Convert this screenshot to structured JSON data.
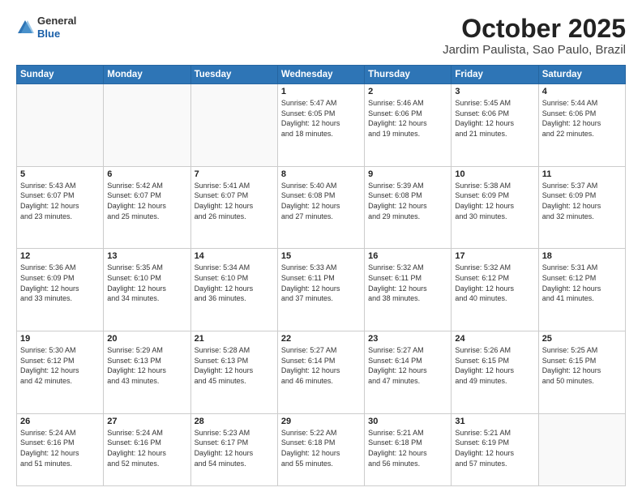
{
  "header": {
    "logo": {
      "line1": "General",
      "line2": "Blue"
    },
    "title": "October 2025",
    "subtitle": "Jardim Paulista, Sao Paulo, Brazil"
  },
  "weekdays": [
    "Sunday",
    "Monday",
    "Tuesday",
    "Wednesday",
    "Thursday",
    "Friday",
    "Saturday"
  ],
  "weeks": [
    [
      {
        "day": "",
        "info": ""
      },
      {
        "day": "",
        "info": ""
      },
      {
        "day": "",
        "info": ""
      },
      {
        "day": "1",
        "info": "Sunrise: 5:47 AM\nSunset: 6:05 PM\nDaylight: 12 hours\nand 18 minutes."
      },
      {
        "day": "2",
        "info": "Sunrise: 5:46 AM\nSunset: 6:06 PM\nDaylight: 12 hours\nand 19 minutes."
      },
      {
        "day": "3",
        "info": "Sunrise: 5:45 AM\nSunset: 6:06 PM\nDaylight: 12 hours\nand 21 minutes."
      },
      {
        "day": "4",
        "info": "Sunrise: 5:44 AM\nSunset: 6:06 PM\nDaylight: 12 hours\nand 22 minutes."
      }
    ],
    [
      {
        "day": "5",
        "info": "Sunrise: 5:43 AM\nSunset: 6:07 PM\nDaylight: 12 hours\nand 23 minutes."
      },
      {
        "day": "6",
        "info": "Sunrise: 5:42 AM\nSunset: 6:07 PM\nDaylight: 12 hours\nand 25 minutes."
      },
      {
        "day": "7",
        "info": "Sunrise: 5:41 AM\nSunset: 6:07 PM\nDaylight: 12 hours\nand 26 minutes."
      },
      {
        "day": "8",
        "info": "Sunrise: 5:40 AM\nSunset: 6:08 PM\nDaylight: 12 hours\nand 27 minutes."
      },
      {
        "day": "9",
        "info": "Sunrise: 5:39 AM\nSunset: 6:08 PM\nDaylight: 12 hours\nand 29 minutes."
      },
      {
        "day": "10",
        "info": "Sunrise: 5:38 AM\nSunset: 6:09 PM\nDaylight: 12 hours\nand 30 minutes."
      },
      {
        "day": "11",
        "info": "Sunrise: 5:37 AM\nSunset: 6:09 PM\nDaylight: 12 hours\nand 32 minutes."
      }
    ],
    [
      {
        "day": "12",
        "info": "Sunrise: 5:36 AM\nSunset: 6:09 PM\nDaylight: 12 hours\nand 33 minutes."
      },
      {
        "day": "13",
        "info": "Sunrise: 5:35 AM\nSunset: 6:10 PM\nDaylight: 12 hours\nand 34 minutes."
      },
      {
        "day": "14",
        "info": "Sunrise: 5:34 AM\nSunset: 6:10 PM\nDaylight: 12 hours\nand 36 minutes."
      },
      {
        "day": "15",
        "info": "Sunrise: 5:33 AM\nSunset: 6:11 PM\nDaylight: 12 hours\nand 37 minutes."
      },
      {
        "day": "16",
        "info": "Sunrise: 5:32 AM\nSunset: 6:11 PM\nDaylight: 12 hours\nand 38 minutes."
      },
      {
        "day": "17",
        "info": "Sunrise: 5:32 AM\nSunset: 6:12 PM\nDaylight: 12 hours\nand 40 minutes."
      },
      {
        "day": "18",
        "info": "Sunrise: 5:31 AM\nSunset: 6:12 PM\nDaylight: 12 hours\nand 41 minutes."
      }
    ],
    [
      {
        "day": "19",
        "info": "Sunrise: 5:30 AM\nSunset: 6:12 PM\nDaylight: 12 hours\nand 42 minutes."
      },
      {
        "day": "20",
        "info": "Sunrise: 5:29 AM\nSunset: 6:13 PM\nDaylight: 12 hours\nand 43 minutes."
      },
      {
        "day": "21",
        "info": "Sunrise: 5:28 AM\nSunset: 6:13 PM\nDaylight: 12 hours\nand 45 minutes."
      },
      {
        "day": "22",
        "info": "Sunrise: 5:27 AM\nSunset: 6:14 PM\nDaylight: 12 hours\nand 46 minutes."
      },
      {
        "day": "23",
        "info": "Sunrise: 5:27 AM\nSunset: 6:14 PM\nDaylight: 12 hours\nand 47 minutes."
      },
      {
        "day": "24",
        "info": "Sunrise: 5:26 AM\nSunset: 6:15 PM\nDaylight: 12 hours\nand 49 minutes."
      },
      {
        "day": "25",
        "info": "Sunrise: 5:25 AM\nSunset: 6:15 PM\nDaylight: 12 hours\nand 50 minutes."
      }
    ],
    [
      {
        "day": "26",
        "info": "Sunrise: 5:24 AM\nSunset: 6:16 PM\nDaylight: 12 hours\nand 51 minutes."
      },
      {
        "day": "27",
        "info": "Sunrise: 5:24 AM\nSunset: 6:16 PM\nDaylight: 12 hours\nand 52 minutes."
      },
      {
        "day": "28",
        "info": "Sunrise: 5:23 AM\nSunset: 6:17 PM\nDaylight: 12 hours\nand 54 minutes."
      },
      {
        "day": "29",
        "info": "Sunrise: 5:22 AM\nSunset: 6:18 PM\nDaylight: 12 hours\nand 55 minutes."
      },
      {
        "day": "30",
        "info": "Sunrise: 5:21 AM\nSunset: 6:18 PM\nDaylight: 12 hours\nand 56 minutes."
      },
      {
        "day": "31",
        "info": "Sunrise: 5:21 AM\nSunset: 6:19 PM\nDaylight: 12 hours\nand 57 minutes."
      },
      {
        "day": "",
        "info": ""
      }
    ]
  ]
}
